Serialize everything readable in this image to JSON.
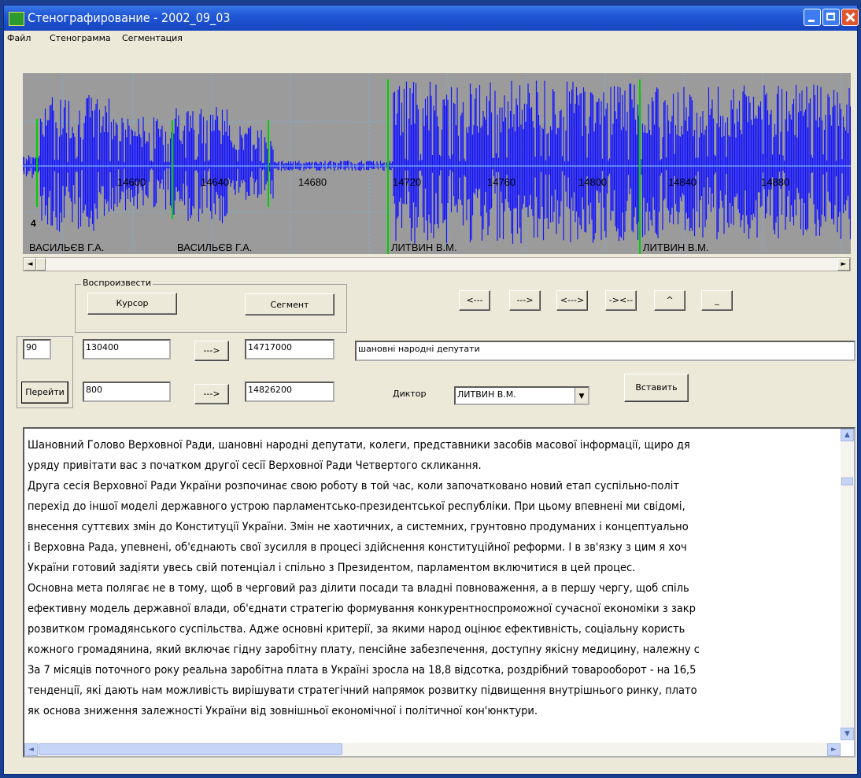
{
  "window": {
    "title": "Стенографирование - 2002_09_03"
  },
  "menu": [
    "Файл",
    "Стенограмма",
    "Сегментация"
  ],
  "waveform": {
    "time_labels": [
      "14600",
      "14640",
      "14680",
      "14720",
      "14760",
      "14800",
      "14840",
      "14880"
    ],
    "segment_number": "4",
    "speaker_labels": [
      "ВАСИЛЬЄВ Г.А.",
      "ВАСИЛЬЄВ Г.А.",
      "ЛИТВИН В.М.",
      "ЛИТВИН В.М."
    ]
  },
  "playback": {
    "group_label": "Воспроизвести",
    "cursor_button": "Курсор",
    "segment_button": "Сегмент"
  },
  "nav_buttons": [
    "<---",
    "--->",
    "<--->",
    "-><--",
    "^",
    "_"
  ],
  "row1": {
    "field_a": "90",
    "field_b": "130400",
    "arrow_button": "--->",
    "field_c": "14717000",
    "transcript_field": "шановні народні депутати"
  },
  "row2": {
    "goto_button": "Перейти",
    "field_b": "800",
    "arrow_button": "--->",
    "field_c": "14826200",
    "speaker_label": "Диктор",
    "speaker_value": "ЛИТВИН В.М.",
    "insert_button": "Вставить"
  },
  "transcript": {
    "lines": [
      "Шановний Голово Верховної Ради, шановні народні депутати, колеги, представники засобів масової інформації, щиро дя",
      "уряду привітати вас з початком другої сесії Верховної Ради Четвертого скликання.",
      "Друга сесія Верховної Ради України розпочинає свою роботу в той час, коли започатковано новий етап суспільно-політ",
      "перехід до іншої моделі державного устрою парламентсько-президентської республіки. При цьому впевнені ми свідомі,",
      "внесення суттєвих змін до Конституції України. Змін не хаотичних, а системних, грунтовно продуманих і концептуально",
      "і Верховна Рада, упевнені, об'єднають свої зусилля в процесі здійснення конституційної реформи. І в зв'язку з цим я хоч",
      "України готовий задіяти увесь свій потенціал і спільно з Президентом, парламентом включитися в цей процес.",
      "Основна мета полягає не в тому, щоб в черговий раз ділити посади та владні повноваження, а в першу чергу, щоб спіль",
      "ефективну модель державної влади, об'єднати стратегію формування конкурентноспроможної сучасної економіки з закр",
      "розвитком громадянського суспільства. Адже основні критерії, за якими народ оцінює ефективність, соціальну користь",
      "кожного громадянина, який включає гідну заробітну плату, пенсійне забезпечення, доступну якісну медицину, належну с",
      "За 7 місяців поточного року реальна заробітна плата в Україні зросла на 18,8 відсотка, роздрібний товарооборот - на 16,5",
      "тенденції, які дають нам можливість вирішувати стратегічний напрямок розвитку підвищення внутрішнього ринку, плато",
      "як основа зниження залежності України від зовнішньої економічної і політичної кон'юнктури."
    ]
  },
  "colors": {
    "waveform": "#1414ff",
    "segment_marker": "#00d000",
    "waveform_bg": "#9b9b9b"
  }
}
